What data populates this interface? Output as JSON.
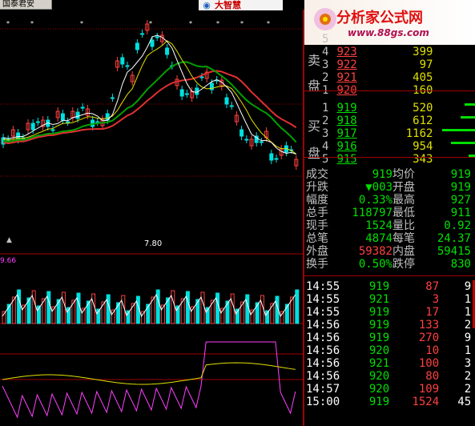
{
  "stock_tab": "国泰君安",
  "brand_logo": "大智慧",
  "watermark": {
    "title": "分析家公式网",
    "url": "www.88gs.com"
  },
  "chart_annotations": {
    "low_label": "7.80",
    "ind_label": "9.66"
  },
  "orderbook": {
    "sell_label_a": "卖",
    "sell_label_b": "盘",
    "buy_label_a": "买",
    "buy_label_b": "盘",
    "sell": [
      {
        "lvl": "5",
        "price": "",
        "vol": ""
      },
      {
        "lvl": "4",
        "price": "923",
        "vol": "399"
      },
      {
        "lvl": "3",
        "price": "922",
        "vol": "97"
      },
      {
        "lvl": "2",
        "price": "921",
        "vol": "405"
      },
      {
        "lvl": "1",
        "price": "920",
        "vol": "160"
      }
    ],
    "buy": [
      {
        "lvl": "1",
        "price": "919",
        "vol": "520"
      },
      {
        "lvl": "2",
        "price": "918",
        "vol": "612"
      },
      {
        "lvl": "3",
        "price": "917",
        "vol": "1162"
      },
      {
        "lvl": "4",
        "price": "916",
        "vol": "954"
      },
      {
        "lvl": "5",
        "price": "915",
        "vol": "343"
      }
    ]
  },
  "stats": [
    {
      "l1": "成交",
      "v1": "919",
      "l2": "均价",
      "v2": "919"
    },
    {
      "l1": "升跌",
      "v1": "▼003",
      "l2": "开盘",
      "v2": "919"
    },
    {
      "l1": "幅度",
      "v1": "0.33%",
      "l2": "最高",
      "v2": "927"
    },
    {
      "l1": "总手",
      "v1": "118797",
      "l2": "最低",
      "v2": "911"
    },
    {
      "l1": "现手",
      "v1": "1524",
      "l2": "量比",
      "v2": "0.92"
    },
    {
      "l1": "总笔",
      "v1": "4874",
      "l2": "每笔",
      "v2": "24.37"
    },
    {
      "l1": "外盘",
      "v1": "59382",
      "l2": "内盘",
      "v2": "59415"
    },
    {
      "l1": "换手",
      "v1": "0.50%",
      "l2": "跌停",
      "v2": "830"
    }
  ],
  "ticks": [
    {
      "t": "14:55",
      "p": "919",
      "v": "87",
      "n": "9"
    },
    {
      "t": "14:55",
      "p": "921",
      "v": "3",
      "n": "1"
    },
    {
      "t": "14:55",
      "p": "919",
      "v": "17",
      "n": "1"
    },
    {
      "t": "14:56",
      "p": "919",
      "v": "133",
      "n": "2"
    },
    {
      "t": "14:56",
      "p": "919",
      "v": "270",
      "n": "9"
    },
    {
      "t": "14:56",
      "p": "920",
      "v": "10",
      "n": "1"
    },
    {
      "t": "14:56",
      "p": "921",
      "v": "100",
      "n": "3"
    },
    {
      "t": "14:56",
      "p": "920",
      "v": "80",
      "n": "2"
    },
    {
      "t": "14:57",
      "p": "920",
      "v": "109",
      "n": "2"
    },
    {
      "t": "15:00",
      "p": "919",
      "v": "1524",
      "n": "45"
    }
  ],
  "colors": {
    "up": "#ff4040",
    "down": "#00e0e0",
    "ma1": "#ffffff",
    "ma2": "#e0e000",
    "ma3": "#00c000",
    "ma4": "#e03030",
    "grid": "#a00000",
    "ind": "#ff40ff"
  }
}
